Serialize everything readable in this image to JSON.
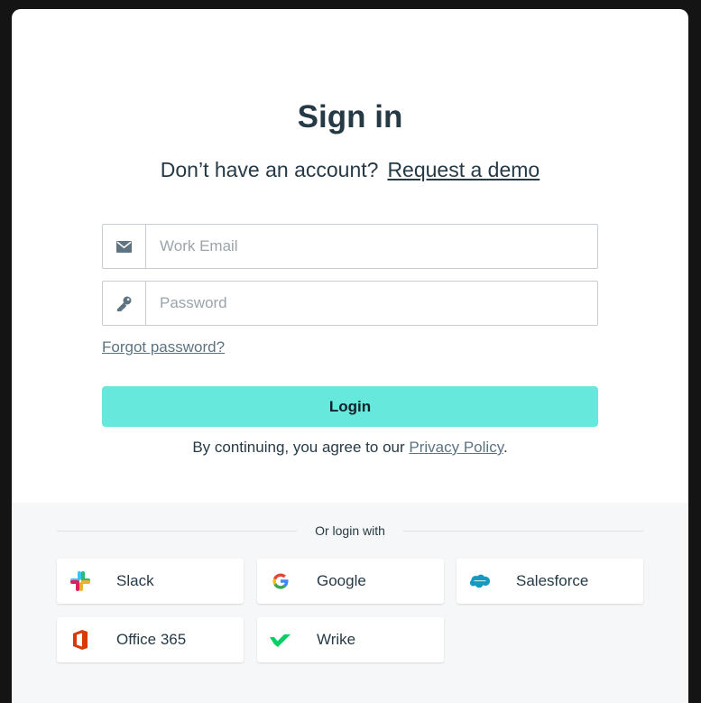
{
  "signin": {
    "title": "Sign in",
    "no_account_text": "Don’t have an account?",
    "request_demo_link": "Request a demo",
    "email_placeholder": "Work Email",
    "password_placeholder": "Password",
    "forgot_password_link": "Forgot password?",
    "login_button": "Login",
    "terms_prefix": "By continuing, you agree to our",
    "privacy_link": "Privacy Policy",
    "terms_suffix": "."
  },
  "sso": {
    "divider_label": "Or login with",
    "providers": [
      {
        "label": "Slack",
        "icon": "slack-icon"
      },
      {
        "label": "Google",
        "icon": "google-icon"
      },
      {
        "label": "Salesforce",
        "icon": "salesforce-icon"
      },
      {
        "label": "Office 365",
        "icon": "office365-icon"
      },
      {
        "label": "Wrike",
        "icon": "wrike-icon"
      }
    ]
  },
  "colors": {
    "accent": "#66e8dc",
    "text": "#263a46",
    "link_muted": "#5c7482",
    "footer_bg": "#f5f7f8"
  }
}
